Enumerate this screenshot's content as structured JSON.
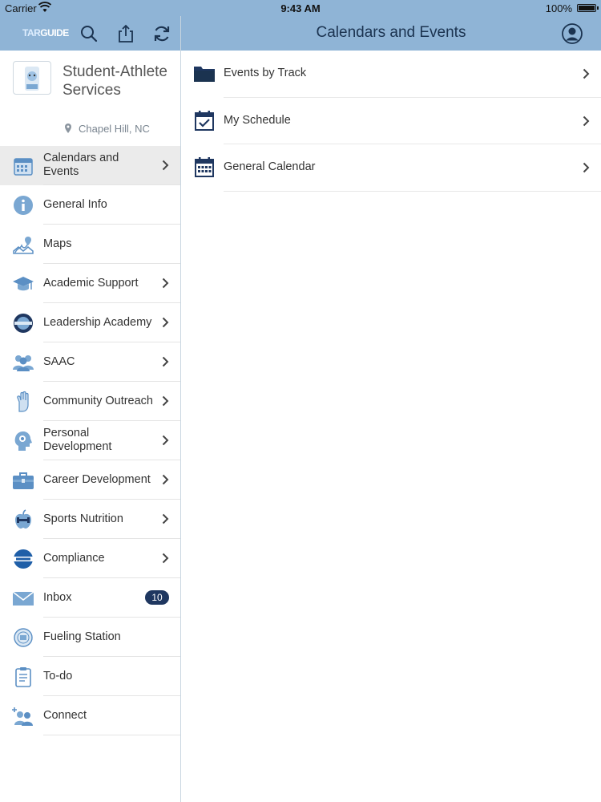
{
  "status_bar": {
    "carrier": "Carrier",
    "time": "9:43 AM",
    "battery": "100%"
  },
  "left_nav": {
    "logo_part1": "TAR",
    "logo_part2": "GUIDE",
    "search_icon": "search-icon",
    "share_icon": "share-icon",
    "refresh_icon": "refresh-icon"
  },
  "right_nav": {
    "title": "Calendars and Events",
    "profile_icon": "profile-icon"
  },
  "org": {
    "name": "Student-Athlete Services",
    "location": "Chapel Hill, NC"
  },
  "sidebar": {
    "items": [
      {
        "label": "Calendars and Events",
        "icon": "calendar-icon",
        "chevron": true,
        "active": true
      },
      {
        "label": "General Info",
        "icon": "info-icon",
        "chevron": false
      },
      {
        "label": "Maps",
        "icon": "map-icon",
        "chevron": false
      },
      {
        "label": "Academic Support",
        "icon": "graduation-cap-icon",
        "chevron": true
      },
      {
        "label": "Leadership Academy",
        "icon": "leadership-seal-icon",
        "chevron": true
      },
      {
        "label": "SAAC",
        "icon": "group-icon",
        "chevron": true
      },
      {
        "label": "Community Outreach",
        "icon": "hand-icon",
        "chevron": true
      },
      {
        "label": "Personal Development",
        "icon": "head-icon",
        "chevron": true
      },
      {
        "label": "Career Development",
        "icon": "briefcase-icon",
        "chevron": true
      },
      {
        "label": "Sports Nutrition",
        "icon": "apple-icon",
        "chevron": true
      },
      {
        "label": "Compliance",
        "icon": "ncaa-icon",
        "chevron": true
      },
      {
        "label": "Inbox",
        "icon": "envelope-icon",
        "badge": "10"
      },
      {
        "label": "Fueling Station",
        "icon": "fueling-seal-icon",
        "chevron": false
      },
      {
        "label": "To-do",
        "icon": "clipboard-icon",
        "chevron": false
      },
      {
        "label": "Connect",
        "icon": "connect-people-icon",
        "chevron": false
      }
    ]
  },
  "main": {
    "rows": [
      {
        "label": "Events by Track",
        "icon": "folder-icon"
      },
      {
        "label": "My Schedule",
        "icon": "calendar-check-icon"
      },
      {
        "label": "General Calendar",
        "icon": "calendar-grid-icon"
      }
    ]
  },
  "colors": {
    "nav_bg": "#8fb4d6",
    "title": "#1b3350",
    "badge_bg": "#1f3760",
    "active_row": "#ebebeb",
    "icon_blue": "#5b8fc4"
  }
}
